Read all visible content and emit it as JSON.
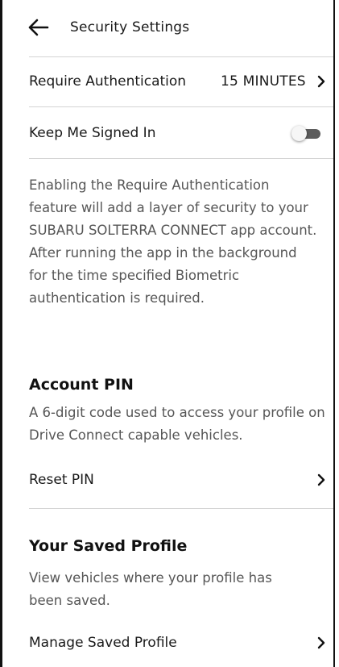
{
  "header": {
    "title": "Security Settings",
    "back_icon": "arrow-left-icon"
  },
  "require_auth": {
    "label": "Require Authentication",
    "value": "15 MINUTES",
    "chevron_icon": "chevron-right-icon"
  },
  "keep_signed_in": {
    "label": "Keep Me Signed In",
    "toggle_state": "off"
  },
  "description": "Enabling the Require Authentication feature will add a layer of security to your SUBARU SOLTERRA CONNECT app account. After running the app in the background for the time specified Biometric authentication is required.",
  "account_pin": {
    "title": "Account PIN",
    "text": "A 6-digit code used to access your profile on Drive Connect capable vehicles.",
    "reset_label": "Reset PIN"
  },
  "saved_profile": {
    "title": "Your Saved Profile",
    "text": "View vehicles where your profile has been saved.",
    "manage_label": "Manage Saved Profile"
  },
  "colors": {
    "text_primary": "#1a1a1a",
    "text_secondary": "#565656",
    "divider": "#d4d4d4",
    "toggle_track": "#5d5d5d"
  }
}
